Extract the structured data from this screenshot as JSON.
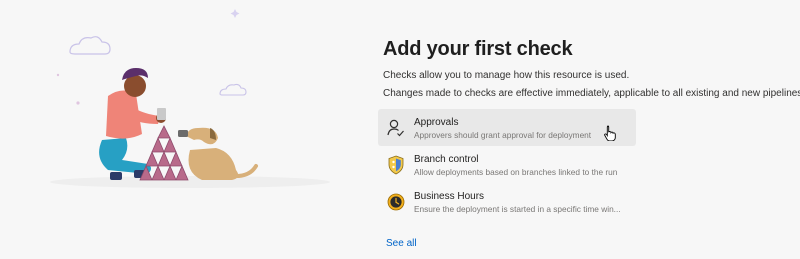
{
  "page": {
    "title": "Add your first check",
    "description_1": "Checks allow you to manage how this resource is used.",
    "description_2": "Changes made to checks are effective immediately, applicable to all existing and new pipelines."
  },
  "checks": [
    {
      "name": "Approvals",
      "description": "Approvers should grant approval for deployment",
      "icon": "person-check-icon"
    },
    {
      "name": "Branch control",
      "description": "Allow deployments based on branches linked to the run",
      "icon": "shield-branch-icon"
    },
    {
      "name": "Business Hours",
      "description": "Ensure the deployment is started in a specific time win...",
      "icon": "clock-icon"
    }
  ],
  "see_all_label": "See all",
  "colors": {
    "link": "#0064c8",
    "hover_bg": "#e8e8e8",
    "background": "#f7f7f7"
  }
}
